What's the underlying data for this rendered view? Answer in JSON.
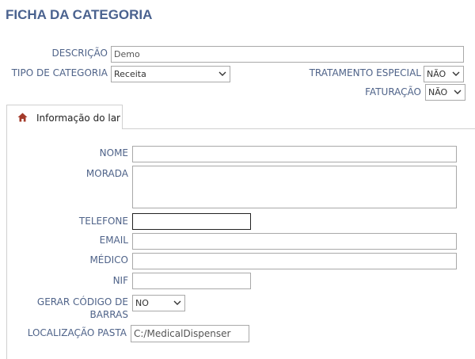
{
  "header": {
    "title": "FICHA DA CATEGORIA"
  },
  "form": {
    "descricao_label": "DESCRIÇÃO",
    "descricao_value": "Demo",
    "tipo_label": "TIPO DE CATEGORIA",
    "tipo_value": "Receita",
    "tratamento_label": "TRATAMENTO ESPECIAL",
    "tratamento_value": "NÃO",
    "faturacao_label": "FATURAÇÃO",
    "faturacao_value": "NÃO"
  },
  "tabs": [
    {
      "label": "Informação do lar",
      "icon": "home-icon",
      "active": true
    }
  ],
  "panel": {
    "nome_label": "NOME",
    "nome_value": "",
    "morada_label": "MORADA",
    "morada_value": "",
    "telefone_label": "TELEFONE",
    "telefone_value": "",
    "email_label": "EMAIL",
    "email_value": "",
    "medico_label": "MÉDICO",
    "medico_value": "",
    "nif_label": "NIF",
    "nif_value": "",
    "codigo_label": "GERAR CÓDIGO DE BARRAS",
    "codigo_value": "NO",
    "pasta_label": "LOCALIZAÇÃO PASTA",
    "pasta_value": "C:/MedicalDispenser"
  },
  "colors": {
    "label": "#4f6389",
    "title": "#4a628f",
    "home_icon": "#a33a2a"
  }
}
